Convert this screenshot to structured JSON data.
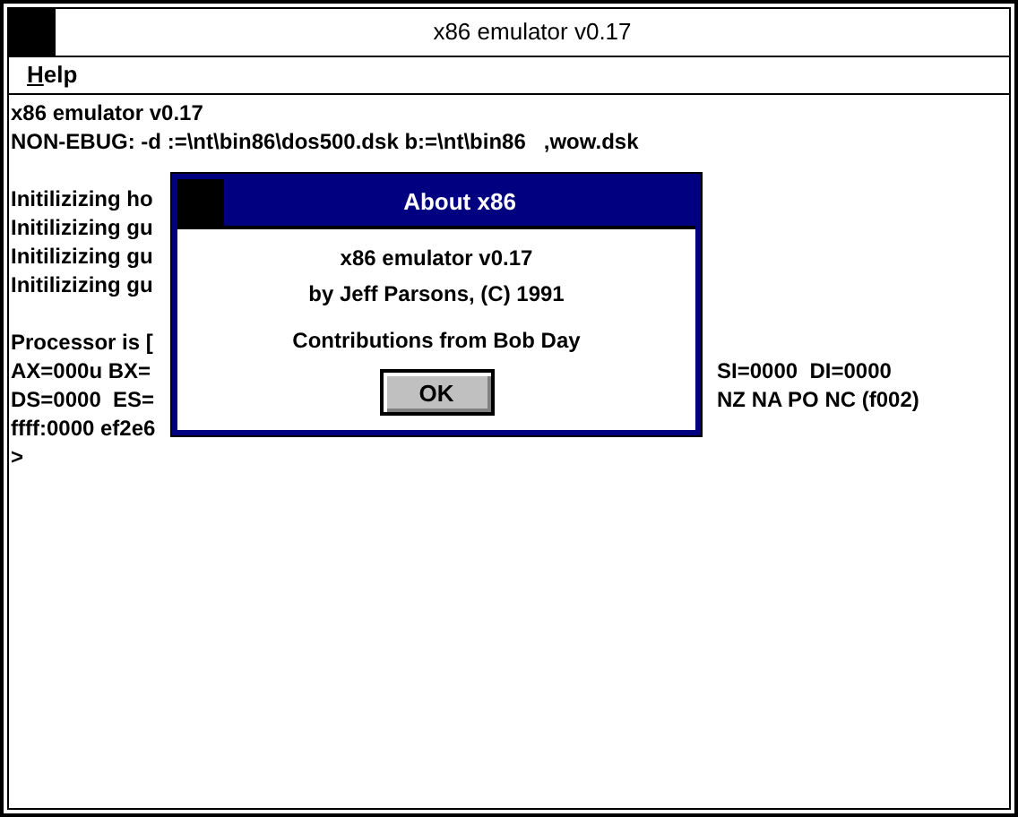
{
  "window": {
    "title": "x86 emulator v0.17"
  },
  "menu": [
    {
      "label": "Help"
    }
  ],
  "console_blocks": [
    {
      "lines": [
        {
          "text": "x86 emulator v0.17"
        },
        {
          "text": "NON-EBUG: -d :=\\nt\\bin86\\dos500.dsk b:=\\nt\\bin86   ,wow.dsk"
        }
      ]
    },
    {
      "lines": [
        {
          "text": "Initilizizing ho"
        },
        {
          "text": "Initilizizing gu"
        },
        {
          "text": "Initilizizing gu"
        },
        {
          "text": "Initilizizing gu"
        }
      ]
    },
    {
      "lines": [
        {
          "text": "Processor is ["
        },
        {
          "text": "AX=000u BX=",
          "right": "SI=0000  DI=0000"
        },
        {
          "text": "DS=0000  ES=",
          "right": "NZ NA PO NC (f002)"
        },
        {
          "text": "ffff:0000 ef2e6"
        },
        {
          "text": ">"
        }
      ]
    }
  ],
  "dialog": {
    "title": "About x86",
    "lines": [
      "x86 emulator v0.17",
      "by Jeff Parsons, (C) 1991",
      "Contributions from Bob Day"
    ],
    "button": "OK"
  }
}
